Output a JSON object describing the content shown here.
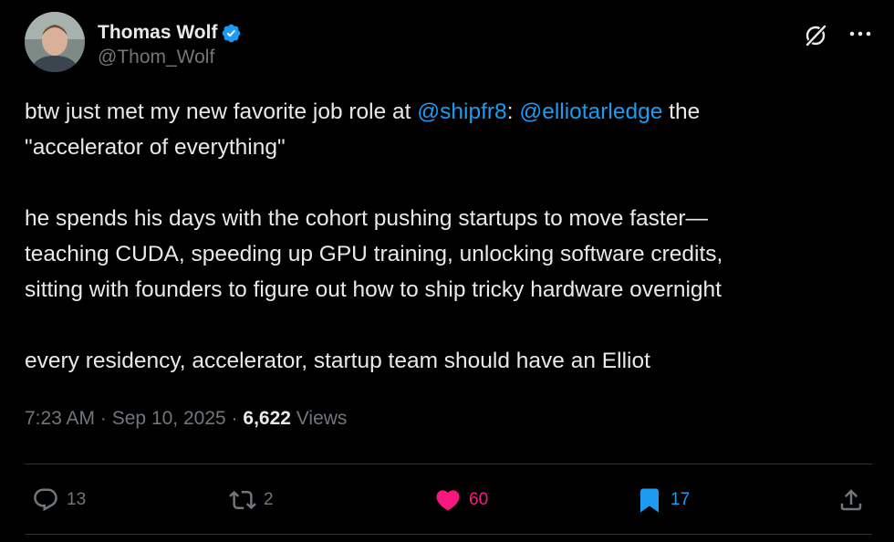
{
  "author": {
    "display_name": "Thomas Wolf",
    "handle": "@Thom_Wolf",
    "verified_icon": "verified-badge-icon"
  },
  "tweet": {
    "paragraphs": [
      {
        "line1_pre": "btw just met my new favorite job role at ",
        "mention1": "@shipfr8",
        "line1_mid": ": ",
        "mention2": "@elliotarledge",
        "line1_post": " the",
        "line2": "\"accelerator of everything\""
      },
      {
        "line1": "he spends his days with the cohort pushing startups to move faster—",
        "line2": "teaching CUDA, speeding up GPU training, unlocking software credits,",
        "line3": "sitting with founders to figure out how to ship tricky hardware overnight"
      },
      {
        "line1": "every residency, accelerator, startup team should have an Elliot"
      }
    ]
  },
  "meta": {
    "time": "7:23 AM",
    "separator": "·",
    "date": "Sep 10, 2025",
    "views_count": "6,622",
    "views_label": "Views"
  },
  "actions": {
    "replies": "13",
    "reposts": "2",
    "likes": "60",
    "bookmarks": "17"
  },
  "colors": {
    "background": "#000000",
    "text": "#e7e9ea",
    "muted": "#71767b",
    "link": "#1d9bf0",
    "like": "#f91880"
  }
}
